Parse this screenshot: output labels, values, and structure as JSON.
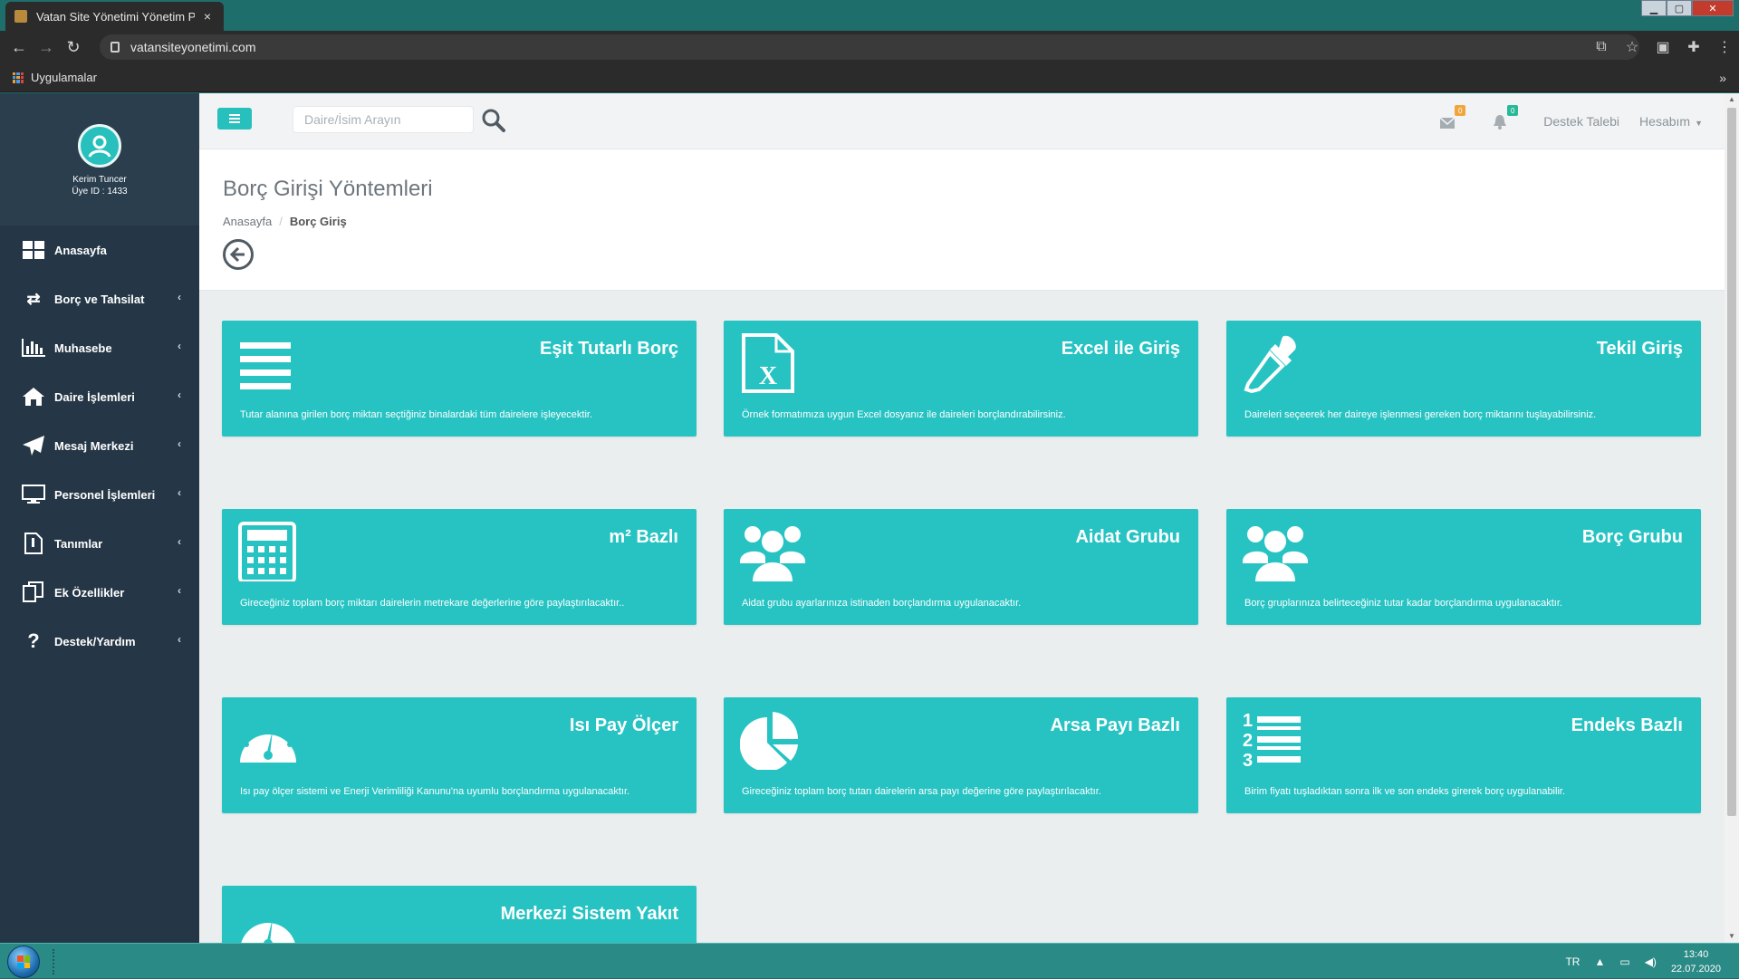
{
  "browser": {
    "tab_title": "Vatan Site Yönetimi Yönetim Pro",
    "tab_close": "×",
    "url": "vatansiteyonetimi.com",
    "bookmarks_label": "Uygulamalar",
    "bookmarks_more": "»"
  },
  "sidebar": {
    "user_name": "Kerim Tuncer",
    "user_id": "Üye ID : 1433",
    "items": [
      {
        "label": "Anasayfa",
        "icon": "dashboard-icon"
      },
      {
        "label": "Borç ve Tahsilat",
        "icon": "exchange-icon"
      },
      {
        "label": "Muhasebe",
        "icon": "bar-chart-icon"
      },
      {
        "label": "Daire İşlemleri",
        "icon": "home-icon"
      },
      {
        "label": "Mesaj Merkezi",
        "icon": "paper-plane-icon"
      },
      {
        "label": "Personel İşlemleri",
        "icon": "monitor-icon"
      },
      {
        "label": "Tanımlar",
        "icon": "document-icon"
      },
      {
        "label": "Ek Özellikler",
        "icon": "copy-icon"
      },
      {
        "label": "Destek/Yardım",
        "icon": "question-icon"
      }
    ],
    "chevron": "‹"
  },
  "topnav": {
    "search_placeholder": "Daire/İsim Arayın",
    "mail_badge": "0",
    "bell_badge": "0",
    "support_link": "Destek Talebi",
    "account_menu": "Hesabım"
  },
  "page": {
    "title": "Borç Girişi Yöntemleri",
    "breadcrumb_home": "Anasayfa",
    "breadcrumb_sep": "/",
    "breadcrumb_current": "Borç Giriş"
  },
  "cards": [
    {
      "title": "Eşit Tutarlı Borç",
      "desc": "Tutar alanına girilen borç miktarı seçtiğiniz binalardaki tüm dairelere işleyecektir.",
      "icon": "list-icon"
    },
    {
      "title": "Excel ile Giriş",
      "desc": "Örnek formatımıza uygun Excel dosyanız ile daireleri borçlandırabilirsiniz.",
      "icon": "excel-file-icon"
    },
    {
      "title": "Tekil Giriş",
      "desc": "Daireleri seçeerek her daireye işlenmesi gereken borç miktarını tuşlayabilirsiniz.",
      "icon": "eyedropper-icon"
    },
    {
      "title": "m² Bazlı",
      "desc": "Gireceğiniz toplam borç miktarı dairelerin metrekare değerlerine göre paylaştırılacaktır..",
      "icon": "calculator-icon"
    },
    {
      "title": "Aidat Grubu",
      "desc": "Aidat grubu ayarlarınıza istinaden borçlandırma uygulanacaktır.",
      "icon": "users-icon"
    },
    {
      "title": "Borç Grubu",
      "desc": "Borç gruplarınıza belirteceğiniz tutar kadar borçlandırma uygulanacaktır.",
      "icon": "users-icon"
    },
    {
      "title": "Isı Pay Ölçer",
      "desc": "Isı pay ölçer sistemi ve Enerji Verimliliği Kanunu'na uyumlu borçlandırma uygulanacaktır.",
      "icon": "gauge-icon"
    },
    {
      "title": "Arsa Payı Bazlı",
      "desc": "Gireceğiniz toplam borç tutarı dairelerin arsa payı değerine göre paylaştırılacaktır.",
      "icon": "pie-chart-icon"
    },
    {
      "title": "Endeks Bazlı",
      "desc": "Birim fiyatı tuşladıktan sonra ilk ve son endeks girerek borç uygulanabilir.",
      "icon": "numbered-list-icon"
    },
    {
      "title": "Merkezi Sistem Yakıt",
      "desc": "",
      "icon": "gauge-icon"
    }
  ],
  "taskbar": {
    "language": "TR",
    "time": "13:40",
    "date": "22.07.2020"
  },
  "colors": {
    "accent": "#27c3c3",
    "sidebar": "#253746",
    "taskbar": "#2a8a86"
  }
}
